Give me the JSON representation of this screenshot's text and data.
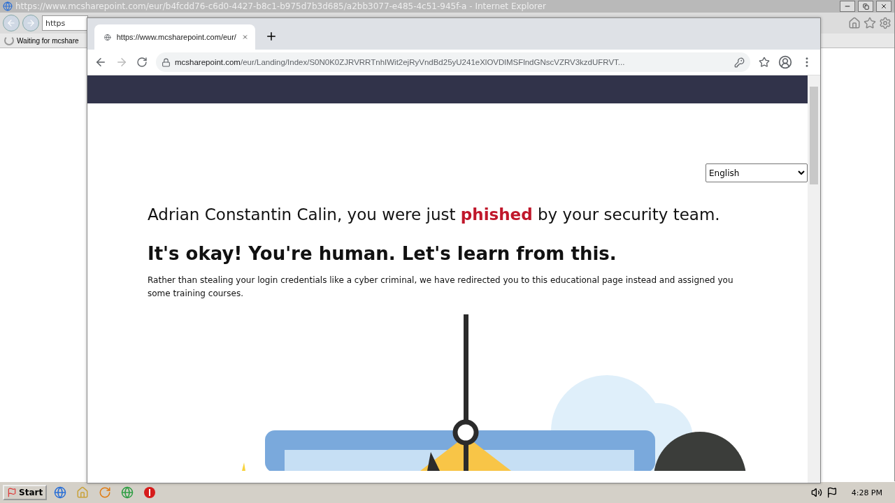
{
  "ie_window": {
    "title": "https://www.mcsharepoint.com/eur/b4fcdd76-c6d0-4427-b8c1-b975d7b3d685/a2bb3077-e485-4c51-945f-a - Internet Explorer",
    "address_partial": "https",
    "status": "Waiting for mcshare"
  },
  "browser": {
    "tab": {
      "title": "https://www.mcsharepoint.com/eur/",
      "selected": true
    },
    "url": {
      "domain": "mcsharepoint.com",
      "path": "/eur/Landing/Index/S0N0K0ZJRVRRTnhIWit2ejRyVndBd25yU241eXlOVDlMSFlndGNscVZRV3kzdUFRVT..."
    }
  },
  "page": {
    "language": "English",
    "headline": "Adrian Constantin Calin, you were just **phished** by your security team.",
    "subheadline": "It's okay! You're human. Let's learn from this.",
    "body": "Rather than stealing your login credentials like a cyber criminal, we have redirected you to this educational page instead and assigned you some training courses."
  },
  "taskbar": {
    "start": "Start",
    "clock": "4:28 PM"
  }
}
